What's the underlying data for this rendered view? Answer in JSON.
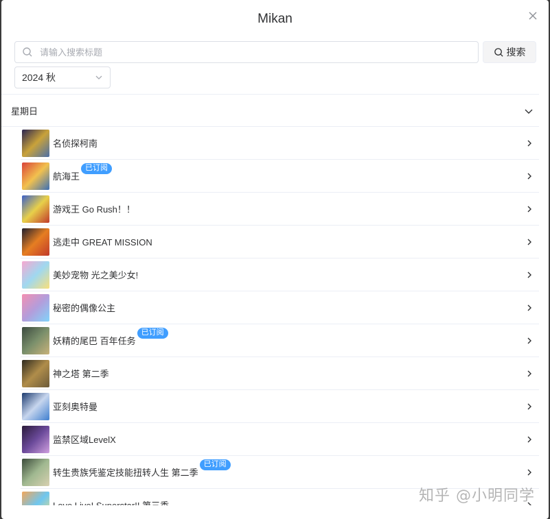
{
  "dialog": {
    "title": "Mikan",
    "close_icon": "close-icon"
  },
  "search": {
    "placeholder": "请输入搜索标题",
    "value": "",
    "button_label": "搜索"
  },
  "season": {
    "selected": "2024 秋"
  },
  "day_group": {
    "label": "星期日",
    "expanded": true
  },
  "items": [
    {
      "title": "名侦探柯南",
      "subscribed": false,
      "badge": "",
      "thumb_colors": [
        "#2a2450",
        "#c9a23a",
        "#4b6fa8"
      ]
    },
    {
      "title": "航海王",
      "subscribed": true,
      "badge": "已订阅",
      "thumb_colors": [
        "#d9433a",
        "#f2c14e",
        "#3b6fb6"
      ]
    },
    {
      "title": "游戏王 Go Rush！！",
      "subscribed": false,
      "badge": "",
      "thumb_colors": [
        "#3a5fc8",
        "#e8d04a",
        "#c0392b"
      ]
    },
    {
      "title": "逃走中 GREAT MISSION",
      "subscribed": false,
      "badge": "",
      "thumb_colors": [
        "#1f1f2e",
        "#e67e22",
        "#c0392b"
      ]
    },
    {
      "title": "美妙宠物 光之美少女!",
      "subscribed": false,
      "badge": "",
      "thumb_colors": [
        "#f7a8d0",
        "#9fd8f0",
        "#f9e07a"
      ]
    },
    {
      "title": "秘密的偶像公主",
      "subscribed": false,
      "badge": "",
      "thumb_colors": [
        "#f48fb1",
        "#b39ddb",
        "#81d4fa"
      ]
    },
    {
      "title": "妖精的尾巴 百年任务",
      "subscribed": true,
      "badge": "已订阅",
      "thumb_colors": [
        "#3b4a3f",
        "#7a8f6b",
        "#c9b27a"
      ]
    },
    {
      "title": "神之塔 第二季",
      "subscribed": false,
      "badge": "",
      "thumb_colors": [
        "#2e2a1f",
        "#b08d4a",
        "#6b5a3a"
      ]
    },
    {
      "title": "亚刻奥特曼",
      "subscribed": false,
      "badge": "",
      "thumb_colors": [
        "#1c3a6e",
        "#c7d6ee",
        "#3f7fcf"
      ]
    },
    {
      "title": "监禁区域LevelX",
      "subscribed": false,
      "badge": "",
      "thumb_colors": [
        "#2a1a3a",
        "#6b4a9a",
        "#d0a0e0"
      ]
    },
    {
      "title": "转生贵族凭鉴定技能扭转人生 第二季",
      "subscribed": true,
      "badge": "已订阅",
      "thumb_colors": [
        "#3a4a3a",
        "#a0b890",
        "#d8d0b0"
      ]
    },
    {
      "title": "Love Live! Superstar!! 第三季",
      "subscribed": false,
      "badge": "",
      "thumb_colors": [
        "#f2a65a",
        "#6ec6f0",
        "#f7e07a"
      ]
    }
  ],
  "watermark": "知乎 @小明同学",
  "colors": {
    "accent": "#409eff",
    "border": "#ebeef5",
    "text": "#303133",
    "placeholder": "#a8abb2"
  }
}
